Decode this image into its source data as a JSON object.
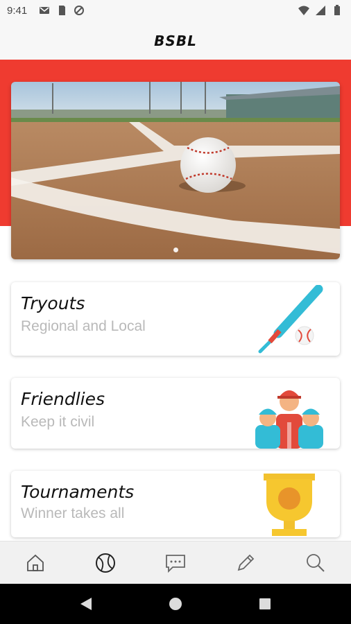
{
  "status_bar": {
    "time": "9:41",
    "left_icons": [
      "mail-icon",
      "sd-card-icon",
      "sync-icon"
    ],
    "right_icons": [
      "wifi-icon",
      "signal-icon",
      "battery-icon"
    ]
  },
  "app_bar": {
    "title": "BSBL"
  },
  "hero": {
    "image": "baseball-on-infield-photo",
    "slides": 1,
    "active_slide": 0
  },
  "cards": [
    {
      "title": "Tryouts",
      "subtitle": "Regional and Local",
      "icon": "bat-and-ball-icon"
    },
    {
      "title": "Friendlies",
      "subtitle": "Keep it civil",
      "icon": "team-players-icon"
    },
    {
      "title": "Tournaments",
      "subtitle": "Winner takes all",
      "icon": "trophy-icon"
    }
  ],
  "bottom_nav": {
    "items": [
      "home-icon",
      "baseball-icon",
      "chat-icon",
      "edit-icon",
      "search-icon"
    ],
    "active": "baseball-icon"
  },
  "system_nav": [
    "back-icon",
    "home-circle-icon",
    "recents-icon"
  ],
  "colors": {
    "accent_red": "#ef3b30",
    "subtitle_gray": "#b9b9b9",
    "nav_bg": "#f1f1f1"
  }
}
